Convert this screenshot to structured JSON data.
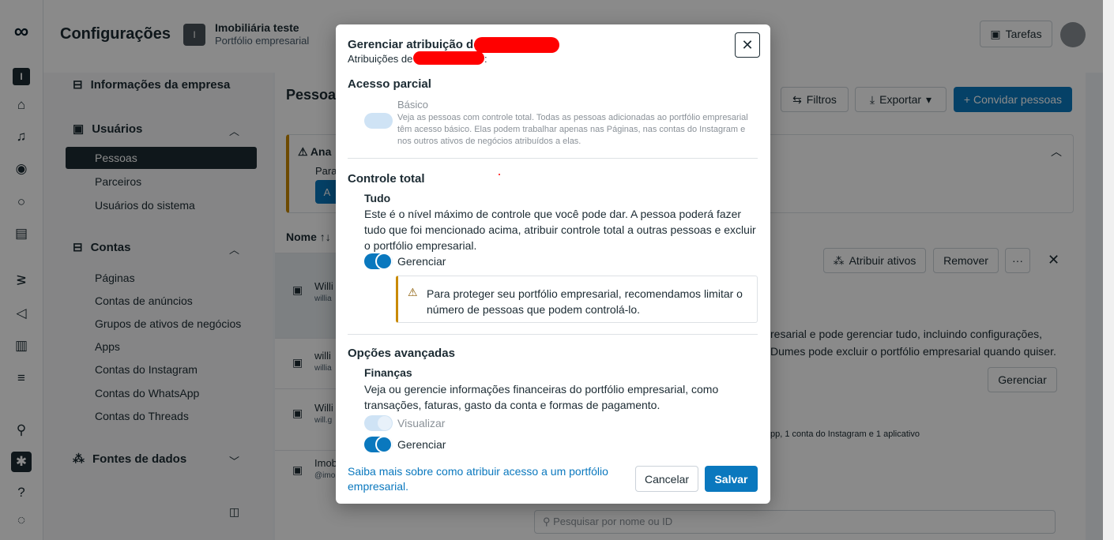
{
  "app": {
    "title": "Configurações",
    "business_name": "Imobiliária teste",
    "business_sub": "Portfólio empresarial",
    "business_initial": "I",
    "tasks_label": "Tarefas"
  },
  "rail": {
    "items": [
      "meta-logo",
      "business-icon",
      "home-icon",
      "bell-icon",
      "compass-icon",
      "chat-icon",
      "inbox-icon",
      "signal-icon",
      "megaphone-icon",
      "bar-chart-icon",
      "menu-icon",
      "search-icon",
      "settings-icon",
      "help-icon",
      "marketing-icon"
    ]
  },
  "sidebar": {
    "info_label": "Informações da empresa",
    "users_label": "Usuários",
    "users_items": [
      "Pessoas",
      "Parceiros",
      "Usuários do sistema"
    ],
    "accounts_label": "Contas",
    "accounts_items": [
      "Páginas",
      "Contas de anúncios",
      "Grupos de ativos de negócios",
      "Apps",
      "Contas do Instagram",
      "Contas do WhatsApp",
      "Contas do Threads"
    ],
    "data_sources_label": "Fontes de dados"
  },
  "main": {
    "title": "Pessoa",
    "filters_label": "Filtros",
    "export_label": "Exportar",
    "invite_label": "+ Convidar pessoas",
    "warn_title": "Ana",
    "warn_body": "Para",
    "warn_btn": "A",
    "name_column": "Nome ↑↓",
    "rows": [
      {
        "name": "Willi",
        "sub": "willia"
      },
      {
        "name": "willi",
        "sub": "willia"
      },
      {
        "name": "Willi",
        "sub": "will.g"
      },
      {
        "name": "Imob",
        "sub": "@imo"
      }
    ],
    "assign_assets_label": "Atribuir ativos",
    "remove_label": "Remover",
    "more_label": "···",
    "detail_line1": "resarial e pode gerenciar tudo, incluindo configurações,",
    "detail_line2": "Dumes pode excluir o portfólio empresarial quando quiser.",
    "manage_label": "Gerenciar",
    "assets_summary": "pp, 1 conta do Instagram e 1 aplicativo",
    "search_placeholder": "Pesquisar por nome ou ID"
  },
  "modal": {
    "title": "Gerenciar atribuição de ",
    "subtitle": "Atribuições de",
    "subtitle_end": ":",
    "partial": {
      "heading": "Acesso parcial",
      "basic_label": "Básico",
      "basic_desc": "Veja as pessoas com controle total. Todas as pessoas adicionadas ao portfólio empresarial têm acesso básico. Elas podem trabalhar apenas nas Páginas, nas contas do Instagram e nos outros ativos de negócios atribuídos a elas."
    },
    "full": {
      "heading": "Controle total",
      "all_label": "Tudo",
      "all_desc": "Este é o nível máximo de controle que você pode dar. A pessoa poderá fazer tudo que foi mencionado acima, atribuir controle total a outras pessoas e excluir o portfólio empresarial.",
      "manage_label": "Gerenciar",
      "warning": "Para proteger seu portfólio empresarial, recomendamos limitar o número de pessoas que podem controlá-lo."
    },
    "advanced": {
      "heading": "Opções avançadas",
      "finance_label": "Finanças",
      "finance_desc": "Veja ou gerencie informações financeiras do portfólio empresarial, como transações, faturas, gasto da conta e formas de pagamento.",
      "view_label": "Visualizar",
      "manage_label": "Gerenciar"
    },
    "learn_more": "Saiba mais sobre como atribuir acesso a um portfólio empresarial.",
    "cancel_label": "Cancelar",
    "save_label": "Salvar",
    "close_symbol": "✕"
  },
  "colors": {
    "accent": "#0a78be",
    "warning": "#c98a00",
    "redaction": "#ff0000"
  }
}
